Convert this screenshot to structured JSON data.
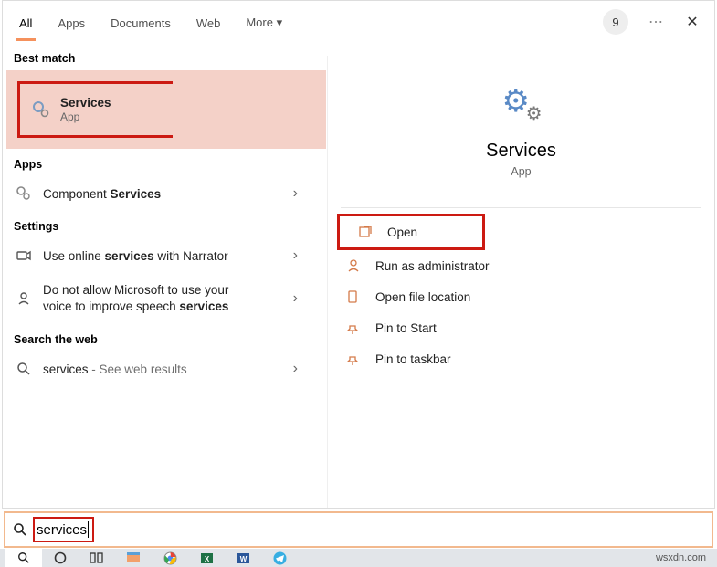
{
  "tabs": {
    "all": "All",
    "apps": "Apps",
    "documents": "Documents",
    "web": "Web",
    "more": "More"
  },
  "badge": "9",
  "sections": {
    "best_match": "Best match",
    "apps": "Apps",
    "settings": "Settings",
    "search_web": "Search the web"
  },
  "best": {
    "title": "Services",
    "subtitle": "App"
  },
  "apps_items": {
    "component_prefix": "Component ",
    "component_bold": "Services"
  },
  "settings_items": {
    "narrator_prefix": "Use online ",
    "narrator_bold": "services",
    "narrator_suffix": " with Narrator",
    "voice_line1": "Do not allow Microsoft to use your",
    "voice_line2_prefix": "voice to improve speech ",
    "voice_line2_bold": "services"
  },
  "web_item": {
    "query": "services",
    "suffix": "See web results"
  },
  "hero": {
    "title": "Services",
    "subtitle": "App"
  },
  "actions": {
    "open": "Open",
    "run_admin": "Run as administrator",
    "open_loc": "Open file location",
    "pin_start": "Pin to Start",
    "pin_taskbar": "Pin to taskbar"
  },
  "searchbox": {
    "query": "services"
  },
  "watermark": "wsxdn.com"
}
